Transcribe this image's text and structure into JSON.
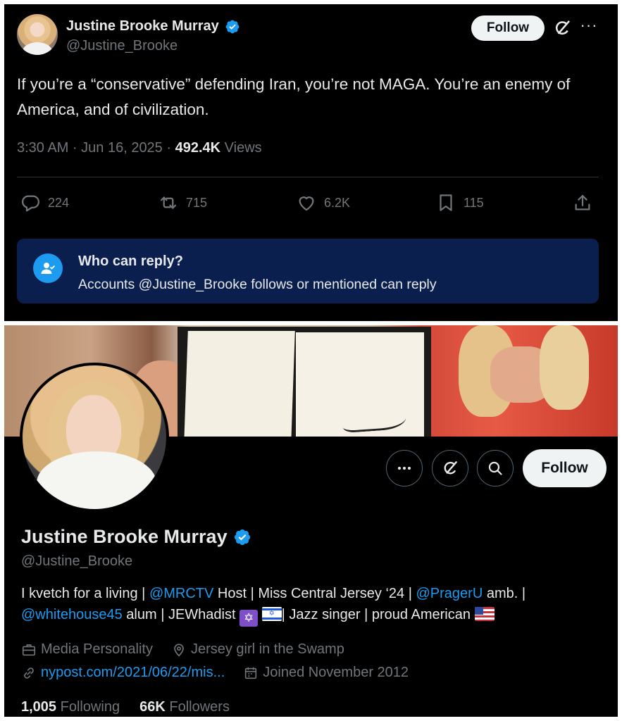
{
  "tweet": {
    "display_name": "Justine Brooke Murray",
    "handle": "@Justine_Brooke",
    "follow_label": "Follow",
    "more_icon": "···",
    "text": "If you’re a “conservative” defending Iran, you’re not MAGA. You’re an enemy of America, and of civilization.",
    "time": "3:30 AM · Jun 16, 2025 · ",
    "views_count": "492.4K",
    "views_label": " Views",
    "actions": {
      "replies": "224",
      "reposts": "715",
      "likes": "6.2K",
      "bookmarks": "115"
    },
    "reply_restriction": {
      "title": "Who can reply?",
      "subtitle": "Accounts @Justine_Brooke follows or mentioned can reply"
    }
  },
  "profile": {
    "display_name": "Justine Brooke Murray",
    "handle": "@Justine_Brooke",
    "follow_label": "Follow",
    "bio": {
      "p1": "I kvetch for a living | ",
      "mention1": "@MRCTV",
      "p2": " Host | Miss Central Jersey ‘24 | ",
      "mention2": "@PragerU",
      "p3": " amb. | ",
      "mention3": "@whitehouse45",
      "p4": " alum | JEWhadist ",
      "p5": "| Jazz singer | proud American "
    },
    "category": "Media Personality",
    "location": "Jersey girl in the Swamp",
    "website": "nypost.com/2021/06/22/mis...",
    "joined": "Joined November 2012",
    "following_count": "1,005",
    "following_label": "Following",
    "followers_count": "66K",
    "followers_label": "Followers"
  },
  "colors": {
    "background": "#000000",
    "text": "#e7e9ea",
    "muted": "#71767b",
    "accent": "#1d9bf0",
    "reply_box": "#0a1f4d"
  }
}
